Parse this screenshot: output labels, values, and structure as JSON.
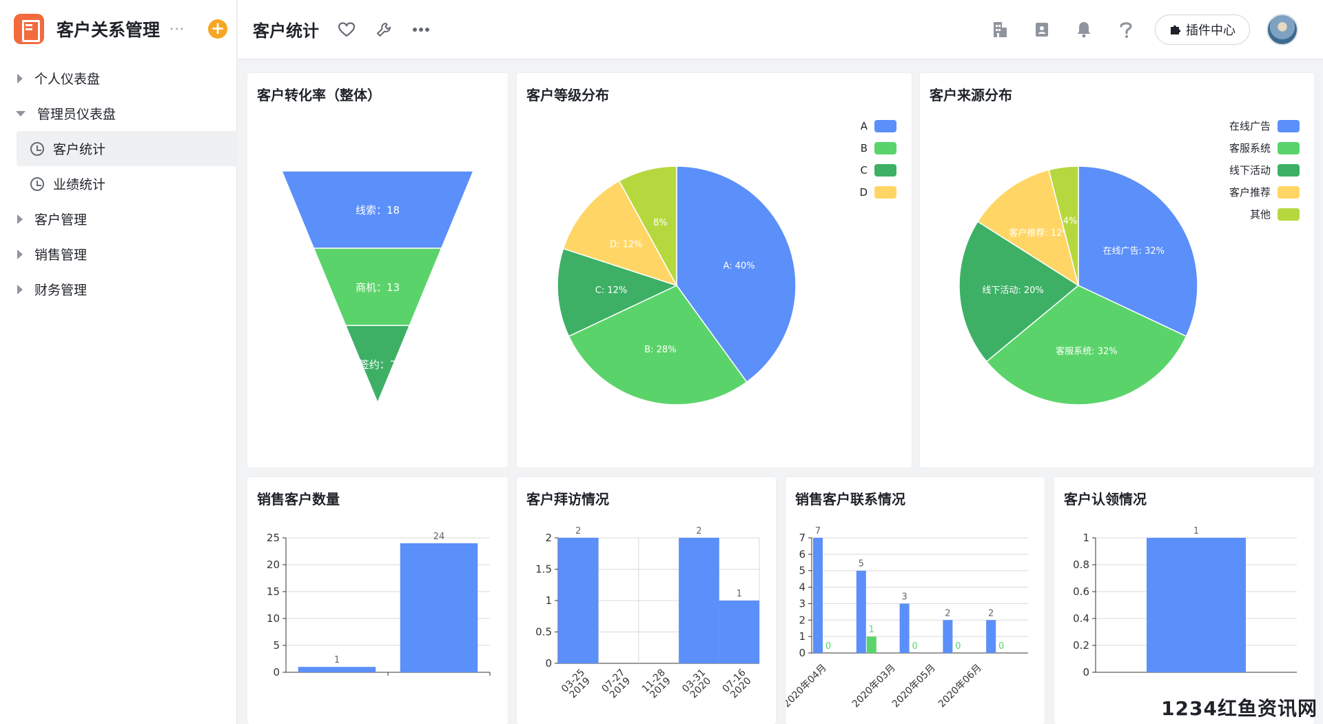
{
  "app": {
    "title": "客户关系管理",
    "more": "···",
    "add": "+"
  },
  "sidebar": {
    "items": [
      {
        "label": "个人仪表盘",
        "type": "group",
        "expanded": false
      },
      {
        "label": "管理员仪表盘",
        "type": "group",
        "expanded": true
      },
      {
        "label": "客户统计",
        "type": "child",
        "active": true,
        "icon": "clock-icon"
      },
      {
        "label": "业绩统计",
        "type": "child",
        "active": false,
        "icon": "clock-icon"
      },
      {
        "label": "客户管理",
        "type": "group",
        "expanded": false
      },
      {
        "label": "销售管理",
        "type": "group",
        "expanded": false
      },
      {
        "label": "财务管理",
        "type": "group",
        "expanded": false
      }
    ]
  },
  "header": {
    "title": "客户统计",
    "icons": [
      "heart-icon",
      "wrench-icon",
      "more-icon"
    ],
    "right_icons": [
      "building-icon",
      "contact-card-icon",
      "bell-icon",
      "help-icon"
    ],
    "plugin_label": "插件中心"
  },
  "colors": {
    "blue": "#5b8ff9",
    "green": "#5ad46a",
    "dark_green": "#3db066",
    "yellow": "#ffd666",
    "lime": "#b6d83f"
  },
  "cards": {
    "funnel": {
      "title": "客户转化率（整体）"
    },
    "grade": {
      "title": "客户等级分布"
    },
    "source": {
      "title": "客户来源分布"
    },
    "sales_count": {
      "title": "销售客户数量"
    },
    "visits": {
      "title": "客户拜访情况"
    },
    "contact": {
      "title": "销售客户联系情况"
    },
    "claim": {
      "title": "客户认领情况"
    }
  },
  "chart_data": [
    {
      "type": "funnel",
      "title": "客户转化率（整体）",
      "stages": [
        {
          "label": "线索：18",
          "name": "线索",
          "value": 18
        },
        {
          "label": "商机：13",
          "name": "商机",
          "value": 13
        },
        {
          "label": "签约：7",
          "name": "签约",
          "value": 7
        }
      ]
    },
    {
      "type": "pie",
      "title": "客户等级分布",
      "legend": "top-right",
      "slices": [
        {
          "name": "A",
          "label": "A: 40%",
          "value": 40
        },
        {
          "name": "B",
          "label": "B: 28%",
          "value": 28
        },
        {
          "name": "C",
          "label": "C: 12%",
          "value": 12
        },
        {
          "name": "D",
          "label": "D: 12%",
          "value": 12
        },
        {
          "name": "",
          "label": "8%",
          "value": 8
        }
      ]
    },
    {
      "type": "pie",
      "title": "客户来源分布",
      "legend": "top-right",
      "slices": [
        {
          "name": "在线广告",
          "label": "在线广告: 32%",
          "value": 32
        },
        {
          "name": "客服系统",
          "label": "客服系统: 32%",
          "value": 32
        },
        {
          "name": "线下活动",
          "label": "线下活动: 20%",
          "value": 20
        },
        {
          "name": "客户推荐",
          "label": "客户推荐: 12%",
          "value": 12
        },
        {
          "name": "其他",
          "label": "4%",
          "value": 4
        }
      ]
    },
    {
      "type": "bar",
      "title": "销售客户数量",
      "categories": [
        "",
        ""
      ],
      "values": [
        1,
        24
      ],
      "value_labels": [
        "1",
        "24"
      ],
      "ylim": [
        0,
        25
      ],
      "yticks": [
        "0",
        "5",
        "10",
        "15",
        "20",
        "25"
      ]
    },
    {
      "type": "bar",
      "title": "客户拜访情况",
      "categories": [
        "03-25\n2019",
        "07-27\n2019",
        "11-28\n2019",
        "03-31\n2020",
        "07-16\n2020"
      ],
      "values": [
        2,
        null,
        null,
        2,
        1
      ],
      "value_labels": [
        "2",
        "",
        "",
        "2",
        "1"
      ],
      "ylim": [
        0,
        2
      ],
      "yticks": [
        "0",
        "0.5",
        "1",
        "1.5",
        "2"
      ]
    },
    {
      "type": "bar",
      "title": "销售客户联系情况",
      "categories": [
        "2020年04月",
        "2020年03月",
        "2020年05月",
        "2020年06月"
      ],
      "series": [
        {
          "values": [
            7,
            5,
            3,
            2,
            2
          ]
        },
        {
          "values": [
            0,
            1,
            0,
            0,
            0
          ]
        }
      ],
      "value_labels_a": [
        "7",
        "5",
        "3",
        "2",
        "2"
      ],
      "value_labels_b": [
        "0",
        "1",
        "0",
        "0",
        "0"
      ],
      "ylim": [
        0,
        7
      ],
      "yticks": [
        "0",
        "1",
        "2",
        "3",
        "4",
        "5",
        "6",
        "7"
      ]
    },
    {
      "type": "bar",
      "title": "客户认领情况",
      "categories": [
        ""
      ],
      "values": [
        1
      ],
      "value_labels": [
        "1"
      ],
      "ylim": [
        0,
        1
      ],
      "yticks": [
        "0",
        "0.2",
        "0.4",
        "0.6",
        "0.8",
        "1"
      ]
    }
  ],
  "watermark": "1234红鱼资讯网"
}
